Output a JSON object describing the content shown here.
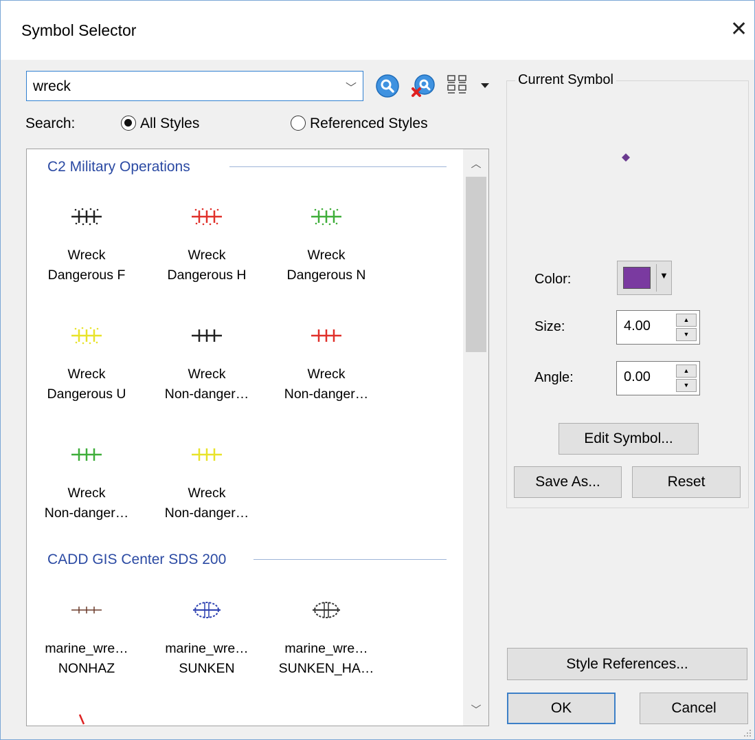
{
  "window": {
    "title": "Symbol Selector",
    "close_glyph": "✕"
  },
  "search": {
    "value": "wreck",
    "dropdown_glyph": "﹀",
    "label": "Search:",
    "options": [
      {
        "label": "All Styles",
        "selected": true
      },
      {
        "label": "Referenced Styles",
        "selected": false
      }
    ],
    "tools": [
      "search-icon",
      "clear-search-icon",
      "view-options-icon"
    ]
  },
  "groups": [
    {
      "name": "C2 Military Operations",
      "symbols": [
        {
          "line1": "Wreck",
          "line2": "Dangerous F",
          "color": "#222222",
          "style": "dotted-cross"
        },
        {
          "line1": "Wreck",
          "line2": "Dangerous H",
          "color": "#e0302a",
          "style": "dotted-cross"
        },
        {
          "line1": "Wreck",
          "line2": "Dangerous N",
          "color": "#3fae3a",
          "style": "dotted-cross"
        },
        {
          "line1": "Wreck",
          "line2": "Dangerous U",
          "color": "#e8e32a",
          "style": "dotted-cross"
        },
        {
          "line1": "Wreck",
          "line2": "Non-danger…",
          "color": "#222222",
          "style": "cross"
        },
        {
          "line1": "Wreck",
          "line2": "Non-danger…",
          "color": "#e0302a",
          "style": "cross"
        },
        {
          "line1": "Wreck",
          "line2": "Non-danger…",
          "color": "#3fae3a",
          "style": "cross"
        },
        {
          "line1": "Wreck",
          "line2": "Non-danger…",
          "color": "#e8e32a",
          "style": "cross"
        }
      ]
    },
    {
      "name": "CADD GIS Center SDS 200",
      "symbols": [
        {
          "line1": "marine_wre…",
          "line2": "NONHAZ",
          "color": "#6b3a2a",
          "style": "thin-cross"
        },
        {
          "line1": "marine_wre…",
          "line2": "SUNKEN",
          "color": "#2b3fb0",
          "style": "ellipse-cross"
        },
        {
          "line1": "marine_wre…",
          "line2": "SUNKEN_HA…",
          "color": "#333333",
          "style": "ellipse-cross"
        }
      ]
    }
  ],
  "current_symbol": {
    "group_title": "Current Symbol",
    "preview_color": "#6a3a8f",
    "color_label": "Color:",
    "color_value": "#7a3aa0",
    "size_label": "Size:",
    "size_value": "4.00",
    "angle_label": "Angle:",
    "angle_value": "0.00",
    "edit_button": "Edit Symbol...",
    "save_button": "Save As...",
    "reset_button": "Reset"
  },
  "footer": {
    "style_references_button": "Style References...",
    "ok_button": "OK",
    "cancel_button": "Cancel"
  }
}
